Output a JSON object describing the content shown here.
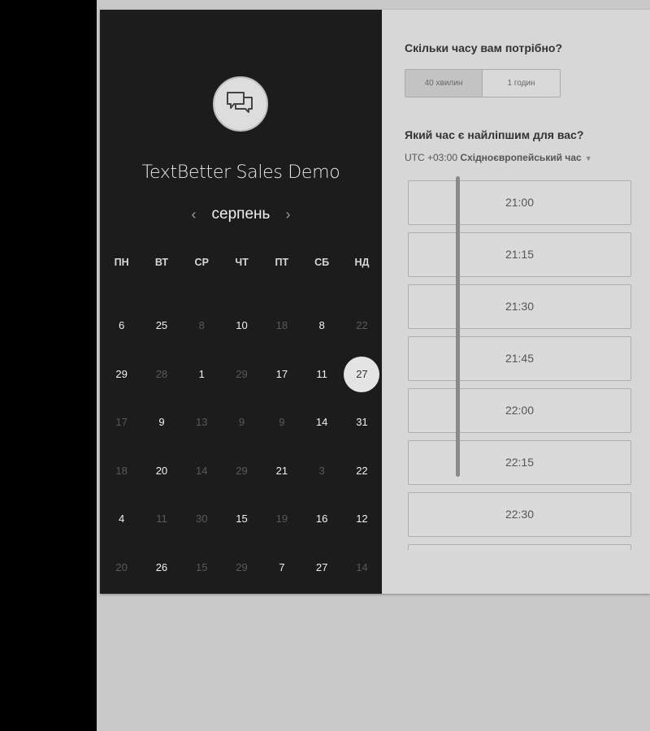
{
  "event": {
    "title": "TextBetter Sales Demo",
    "logo_icon": "chat-bubbles-icon"
  },
  "calendar": {
    "month": "серпень",
    "prev_icon": "chevron-left-icon",
    "next_icon": "chevron-right-icon",
    "weekdays": [
      "ПН",
      "ВТ",
      "СР",
      "ЧТ",
      "ПТ",
      "СБ",
      "НД"
    ],
    "weeks": [
      [
        {
          "d": "6",
          "on": true
        },
        {
          "d": "25",
          "on": true
        },
        {
          "d": "8",
          "on": false
        },
        {
          "d": "10",
          "on": true
        },
        {
          "d": "18",
          "on": false
        },
        {
          "d": "8",
          "on": true
        },
        {
          "d": "22",
          "on": false
        }
      ],
      [
        {
          "d": "29",
          "on": true
        },
        {
          "d": "28",
          "on": false
        },
        {
          "d": "1",
          "on": true
        },
        {
          "d": "29",
          "on": false
        },
        {
          "d": "17",
          "on": true
        },
        {
          "d": "11",
          "on": true
        },
        {
          "d": "27",
          "on": true,
          "selected": true
        }
      ],
      [
        {
          "d": "17",
          "on": false
        },
        {
          "d": "9",
          "on": true
        },
        {
          "d": "13",
          "on": false
        },
        {
          "d": "9",
          "on": false
        },
        {
          "d": "9",
          "on": false
        },
        {
          "d": "14",
          "on": true
        },
        {
          "d": "31",
          "on": true
        }
      ],
      [
        {
          "d": "18",
          "on": false
        },
        {
          "d": "20",
          "on": true
        },
        {
          "d": "14",
          "on": false
        },
        {
          "d": "29",
          "on": false
        },
        {
          "d": "21",
          "on": true
        },
        {
          "d": "3",
          "on": false
        },
        {
          "d": "22",
          "on": true
        }
      ],
      [
        {
          "d": "4",
          "on": true
        },
        {
          "d": "11",
          "on": false
        },
        {
          "d": "30",
          "on": false
        },
        {
          "d": "15",
          "on": true
        },
        {
          "d": "19",
          "on": false
        },
        {
          "d": "16",
          "on": true
        },
        {
          "d": "12",
          "on": true
        }
      ],
      [
        {
          "d": "20",
          "on": false
        },
        {
          "d": "26",
          "on": true
        },
        {
          "d": "15",
          "on": false
        },
        {
          "d": "29",
          "on": false
        },
        {
          "d": "7",
          "on": true
        },
        {
          "d": "27",
          "on": true
        },
        {
          "d": "14",
          "on": false
        }
      ]
    ]
  },
  "scheduler": {
    "duration_question": "Скільки часу вам потрібно?",
    "durations": [
      "40 хвилин",
      "1 годин"
    ],
    "selected_duration": "40 хвилин",
    "time_question": "Який час є найліпшим для вас?",
    "timezone_offset": "UTC +03:00",
    "timezone_name": "Східноєвропейський час",
    "slots": [
      "21:00",
      "21:15",
      "21:30",
      "21:45",
      "22:00",
      "22:15",
      "22:30"
    ]
  }
}
